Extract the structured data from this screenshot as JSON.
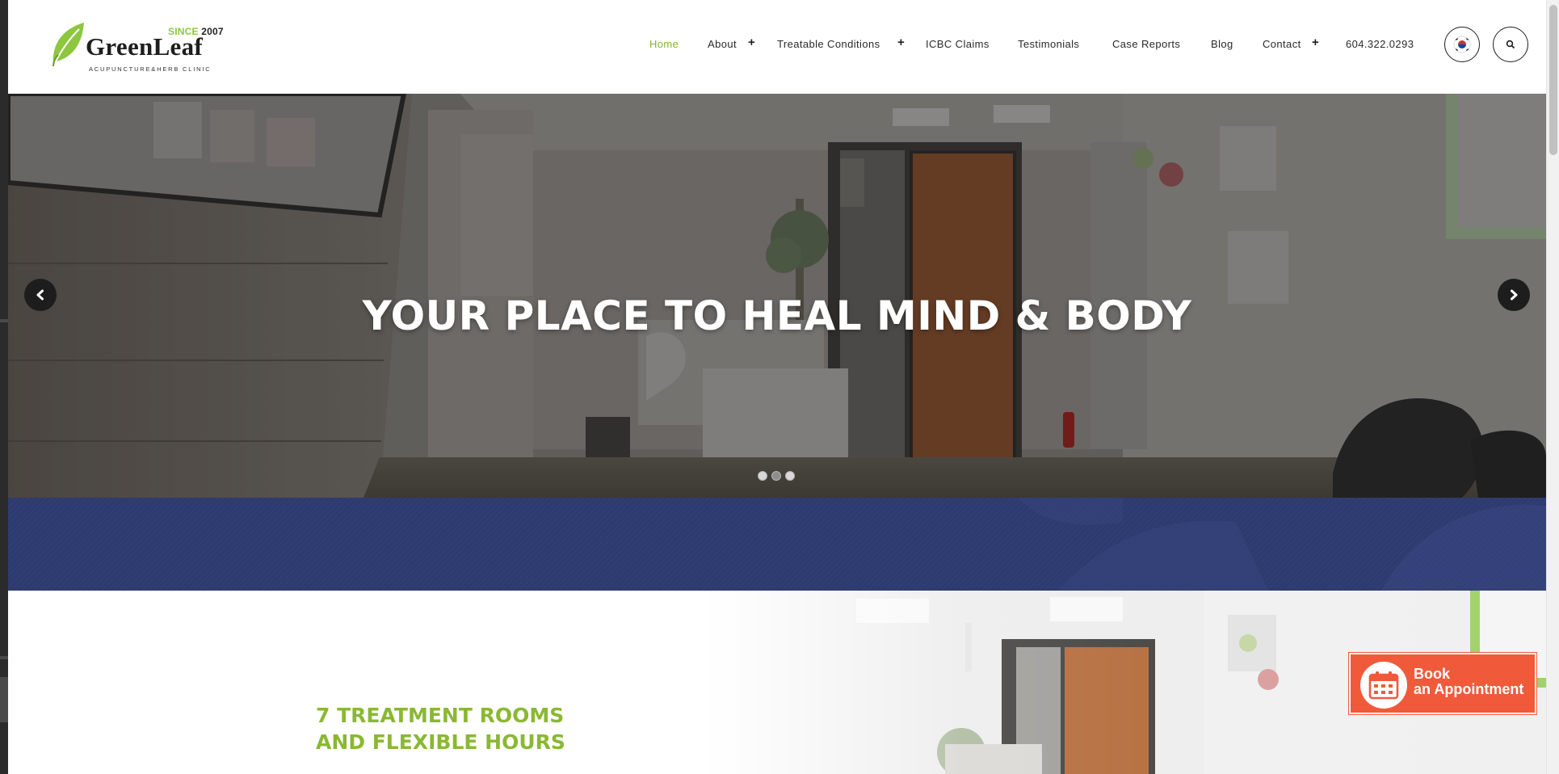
{
  "logo": {
    "since_label": "SINCE",
    "since_year": "2007",
    "brand": "GreenLeaf",
    "tagline": "ACUPUNCTURE&HERB CLINIC"
  },
  "nav": {
    "items": [
      {
        "label": "Home",
        "active": true,
        "has_submenu": false
      },
      {
        "label": "About",
        "active": false,
        "has_submenu": true
      },
      {
        "label": "Treatable Conditions",
        "active": false,
        "has_submenu": true
      },
      {
        "label": "ICBC Claims",
        "active": false,
        "has_submenu": false
      },
      {
        "label": "Testimonials",
        "active": false,
        "has_submenu": false
      },
      {
        "label": "Case Reports",
        "active": false,
        "has_submenu": false
      },
      {
        "label": "Blog",
        "active": false,
        "has_submenu": false
      },
      {
        "label": "Contact",
        "active": false,
        "has_submenu": true
      },
      {
        "label": "604.322.0293",
        "active": false,
        "has_submenu": false
      }
    ],
    "submenu_icon": "plus-icon",
    "language_icon": "korean-flag-icon",
    "search_icon": "search-icon"
  },
  "hero": {
    "title": "YOUR PLACE TO HEAL MIND & BODY",
    "prev_icon": "chevron-left-icon",
    "next_icon": "chevron-right-icon",
    "slide_count": 3,
    "active_slide": 2
  },
  "feature": {
    "heading_line1": "7 TREATMENT ROOMS",
    "heading_line2": "AND FLEXIBLE HOURS"
  },
  "book": {
    "icon": "calendar-icon",
    "line1": "Book",
    "line2": "an Appointment"
  },
  "colors": {
    "brand_green": "#8dc63f",
    "nav_active": "#7fb62d",
    "band_blue": "#2e3c72",
    "book_orange": "#f05a3b",
    "heading_green": "#8ab833"
  }
}
